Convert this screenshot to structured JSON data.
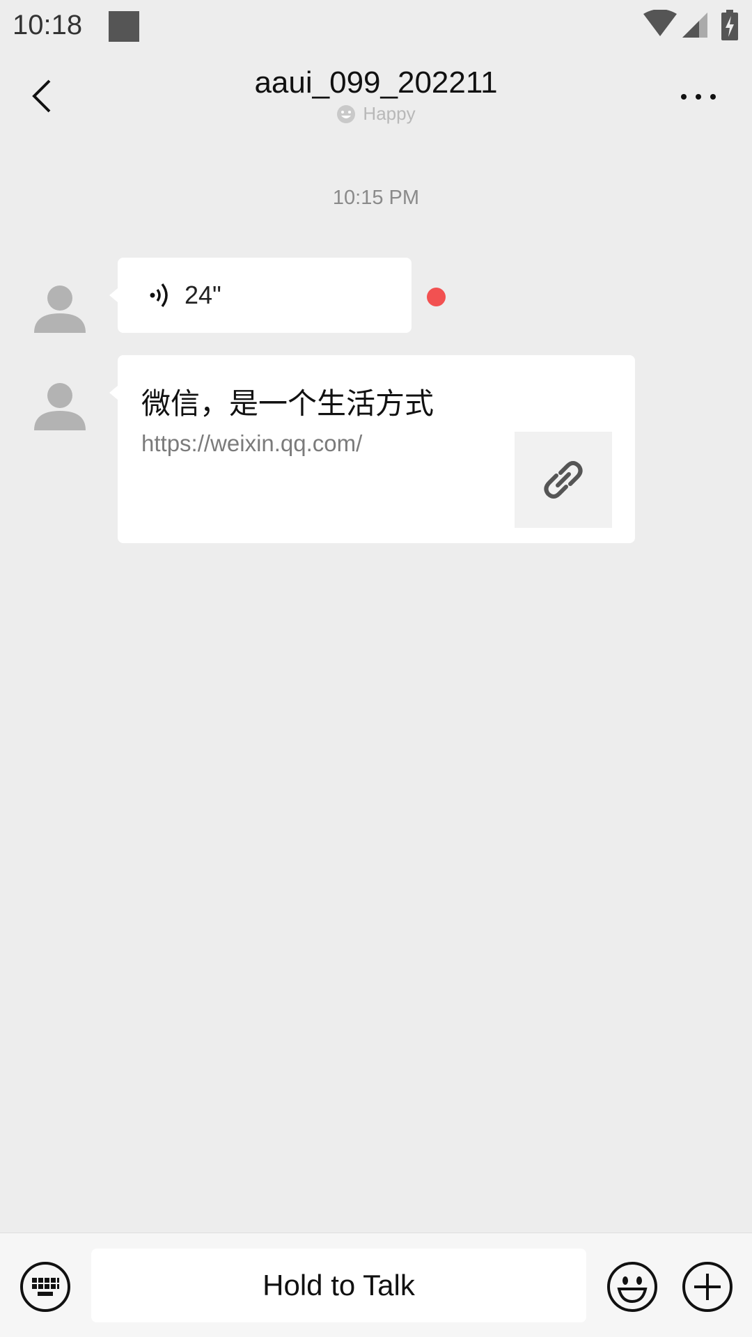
{
  "status_bar": {
    "time": "10:18"
  },
  "header": {
    "title": "aaui_099_202211",
    "status_icon": "happy-face-icon",
    "status_text": "Happy"
  },
  "conversation": {
    "timestamp": "10:15 PM",
    "messages": [
      {
        "type": "voice",
        "duration": "24\"",
        "unread": true
      },
      {
        "type": "link",
        "title": "微信，是一个生活方式",
        "url": "https://weixin.qq.com/",
        "thumbnail_icon": "link-icon"
      }
    ]
  },
  "input_bar": {
    "hold_to_talk_label": "Hold to Talk"
  },
  "colors": {
    "background": "#ededed",
    "bubble": "#ffffff",
    "unread_dot": "#f25151",
    "avatar": "#b3b3b3"
  }
}
